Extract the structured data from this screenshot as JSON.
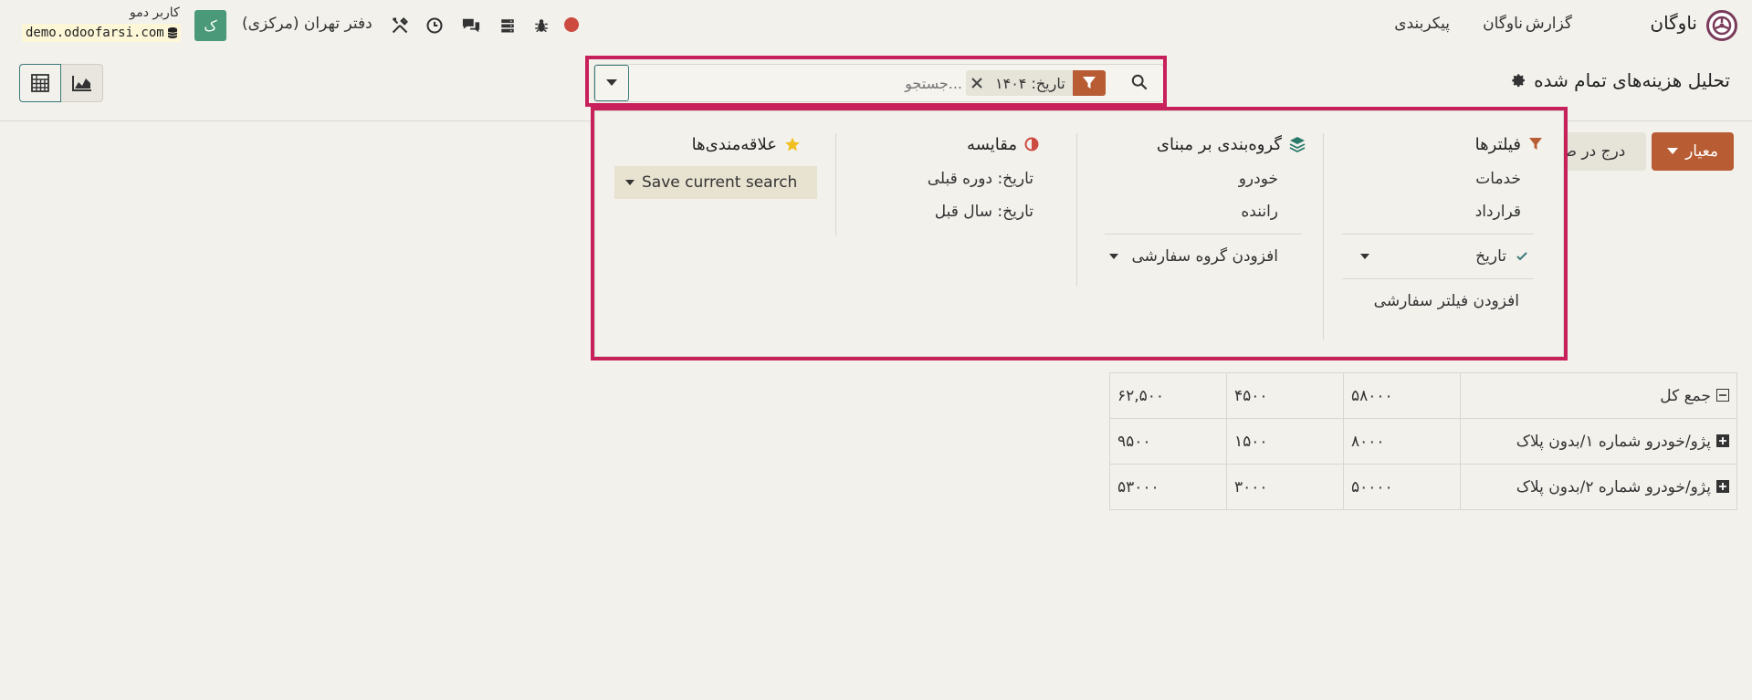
{
  "navbar": {
    "app_name": "ناوگان",
    "menus": [
      "ناوگان",
      "گزارش",
      "پیکربندی"
    ],
    "company": "دفتر تهران (مرکزی)",
    "user_initial": "ک",
    "user_name": "کاربر دمو",
    "db_name": "demo.odoofarsi.com"
  },
  "control": {
    "title": "تحلیل هزینه‌های تمام شده",
    "measure_label": "معیار",
    "insert_label": "درج در صف"
  },
  "search": {
    "placeholder": "جستجو...",
    "facet_value": "تاریخ: ۱۴۰۴"
  },
  "dropdown": {
    "filters": {
      "title": "فیلترها",
      "items": [
        "خدمات",
        "قرارداد"
      ],
      "date_filter": "تاریخ",
      "add_custom": "افزودن فیلتر سفارشی"
    },
    "groupby": {
      "title": "گروه‌بندی بر مبنای",
      "items": [
        "خودرو",
        "راننده"
      ],
      "add_custom": "افزودن گروه سفارشی"
    },
    "compare": {
      "title": "مقایسه",
      "items": [
        "تاریخ: دوره قبلی",
        "تاریخ: سال قبل"
      ]
    },
    "favorites": {
      "title": "علاقه‌مندی‌ها",
      "save_current": "Save current search"
    }
  },
  "pivot": {
    "rows": [
      {
        "label": "جمع کل",
        "values": [
          "۵۸۰۰۰",
          "۴۵۰۰",
          "۶۲,۵۰۰"
        ]
      },
      {
        "label": "پژو/خودرو شماره ۱/بدون پلاک",
        "values": [
          "۸۰۰۰",
          "۱۵۰۰",
          "۹۵۰۰"
        ]
      },
      {
        "label": "پژو/خودرو شماره ۲/بدون پلاک",
        "values": [
          "۵۰۰۰۰",
          "۳۰۰۰",
          "۵۳۰۰۰"
        ]
      }
    ]
  },
  "colors": {
    "accent": "#b85c34",
    "highlight": "#c8205a",
    "avatar": "#4a9a7a",
    "record_dot": "#cc4a3f"
  },
  "icons": [
    "app-logo-icon",
    "bug-icon",
    "server-icon",
    "chat-icon",
    "clock-icon",
    "tools-icon",
    "database-icon",
    "gear-icon",
    "pivot-view-icon",
    "graph-view-icon",
    "search-icon",
    "filter-icon",
    "close-icon",
    "caret-down-icon",
    "layers-icon",
    "half-circle-icon",
    "star-icon",
    "check-icon",
    "plus-square-icon",
    "minus-square-icon"
  ]
}
